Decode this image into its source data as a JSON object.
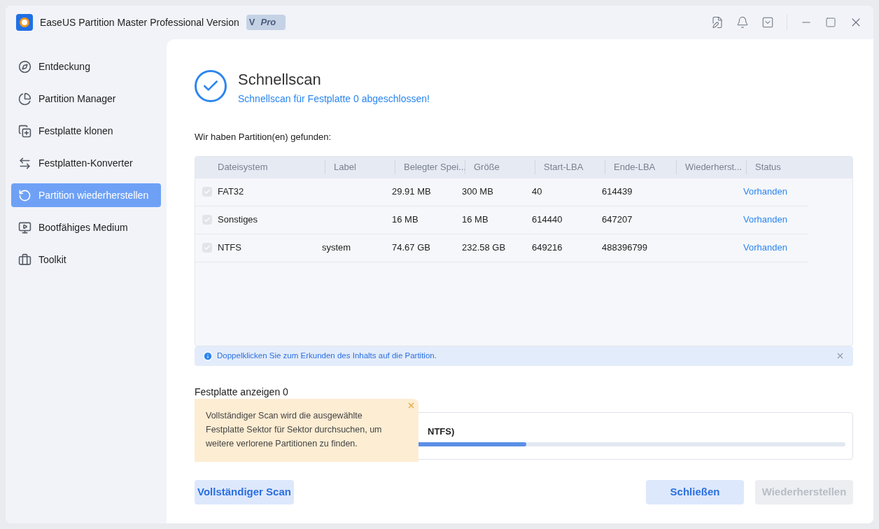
{
  "window": {
    "title": "EaseUS Partition Master Professional Version",
    "badge": "Pro",
    "badge_mark": "V"
  },
  "sidebar": {
    "items": [
      {
        "label": "Entdeckung",
        "selected": false
      },
      {
        "label": "Partition Manager",
        "selected": false
      },
      {
        "label": "Festplatte klonen",
        "selected": false
      },
      {
        "label": "Festplatten-Konverter",
        "selected": false
      },
      {
        "label": "Partition wiederherstellen",
        "selected": true
      },
      {
        "label": "Bootfähiges Medium",
        "selected": false
      },
      {
        "label": "Toolkit",
        "selected": false
      }
    ]
  },
  "header": {
    "title": "Schnellscan",
    "subtitle": "Schnellscan für Festplatte 0 abgeschlossen!"
  },
  "found_label": "Wir haben Partition(en) gefunden:",
  "table": {
    "columns": [
      "Dateisystem",
      "Label",
      "Belegter Spei...",
      "Größe",
      "Start-LBA",
      "Ende-LBA",
      "Wiederherst...",
      "Status"
    ],
    "rows": [
      {
        "checked": true,
        "cells": [
          "FAT32",
          "",
          "29.91 MB",
          "300 MB",
          "40",
          "614439",
          "",
          "Vorhanden"
        ]
      },
      {
        "checked": true,
        "cells": [
          "Sonstiges",
          "",
          "16 MB",
          "16 MB",
          "614440",
          "647207",
          "",
          "Vorhanden"
        ]
      },
      {
        "checked": true,
        "cells": [
          "NTFS",
          "system",
          "74.67 GB",
          "232.58 GB",
          "649216",
          "488396799",
          "",
          "Vorhanden"
        ]
      }
    ]
  },
  "info_bar": {
    "text": "Doppelklicken Sie zum Erkunden des Inhalts auf die Partition."
  },
  "disk": {
    "heading": "Festplatte anzeigen 0",
    "partition_label": "NTFS)",
    "level": 0.5
  },
  "tooltip": {
    "text": "Vollständiger Scan wird die ausgewählte Festplatte Sektor für Sektor durchsuchen, um weitere verlorene Partitionen zu finden."
  },
  "buttons": [
    {
      "label": "Vollständiger Scan",
      "disabled": false
    },
    {
      "label": "Schließen",
      "disabled": false
    },
    {
      "label": "Wiederherstellen",
      "disabled": true
    }
  ]
}
